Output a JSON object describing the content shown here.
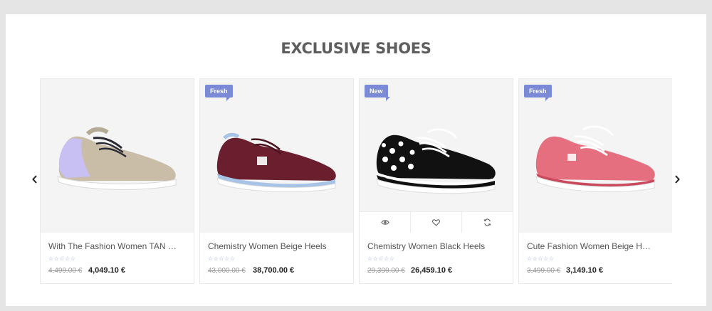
{
  "section": {
    "title": "EXCLUSIVE SHOES"
  },
  "colors": {
    "badge": "#7a8ad6",
    "card_bg": "#f4f4f4",
    "star": "#8f9bd8"
  },
  "carousel": {
    "prev_icon": "chevron-left-icon",
    "next_icon": "chevron-right-icon"
  },
  "products": [
    {
      "name": "With The Fashion Women TAN He...",
      "badge": "",
      "stars": "☆☆☆☆☆",
      "old_price": "4,499.00 €",
      "price": "4,049.10 €"
    },
    {
      "name": "Chemistry Women Beige Heels",
      "badge": "Fresh",
      "stars": "☆☆☆☆☆",
      "old_price": "43,000.00 €",
      "price": "38,700.00 €"
    },
    {
      "name": "Chemistry Women Black Heels",
      "badge": "New",
      "stars": "☆☆☆☆☆",
      "old_price": "29,399.00 €",
      "price": "26,459.10 €",
      "actions": [
        "eye-icon",
        "heart-icon",
        "refresh-icon"
      ]
    },
    {
      "name": "Cute Fashion Women Beige Heels",
      "badge": "Fresh",
      "stars": "☆☆☆☆☆",
      "old_price": "3,499.00 €",
      "price": "3,149.10 €"
    }
  ]
}
